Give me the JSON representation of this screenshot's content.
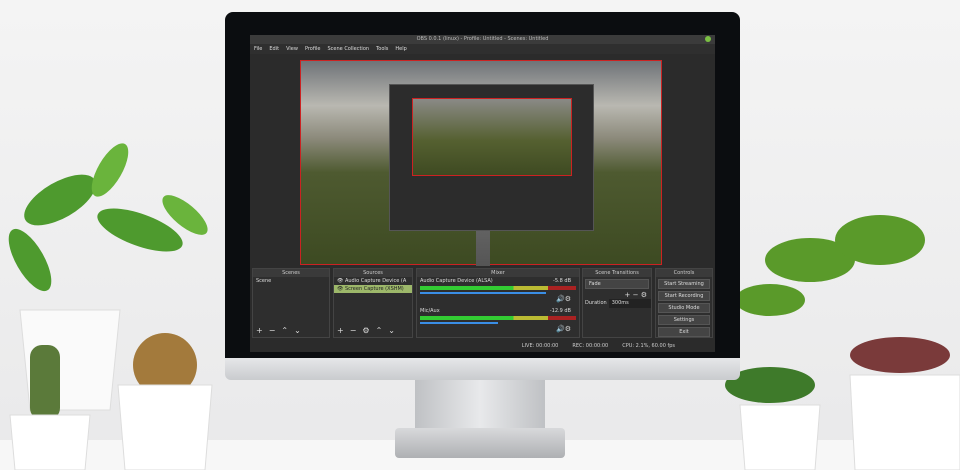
{
  "window": {
    "title": "OBS 0.0.1 (linux) - Profile: Untitled - Scenes: Untitled"
  },
  "menu": [
    "File",
    "Edit",
    "View",
    "Profile",
    "Scene Collection",
    "Tools",
    "Help"
  ],
  "docks": {
    "scenes": "Scenes",
    "sources": "Sources",
    "mixer": "Mixer",
    "transitions": "Scene Transitions",
    "controls": "Controls"
  },
  "scenes": [
    "Scene"
  ],
  "sources": [
    "Audio Capture Device (A",
    "Screen Capture (XSHM)"
  ],
  "mixer": [
    {
      "name": "Audio Capture Device (ALSA)",
      "db": "-5.8 dB",
      "level": 0.55,
      "volume": 0.8
    },
    {
      "name": "Mic/Aux",
      "db": "-12.9 dB",
      "level": 0.3,
      "volume": 0.55
    }
  ],
  "transition": {
    "selected": "Fade",
    "duration_label": "Duration",
    "duration": "300ms"
  },
  "controls": [
    "Start Streaming",
    "Start Recording",
    "Studio Mode",
    "Settings",
    "Exit"
  ],
  "status": {
    "live": "LIVE: 00:00:00",
    "rec": "REC: 00:00:00",
    "cpu": "CPU: 2.1%, 60.00 fps"
  },
  "colors": {
    "accent": "#9db86a",
    "preview_border": "#cc2222",
    "meter_green": "#33cc33"
  }
}
